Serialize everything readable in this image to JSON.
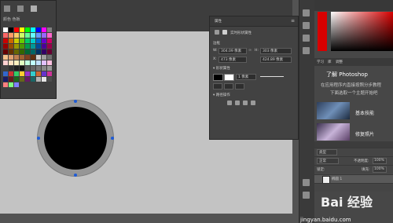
{
  "swatches_panel": {
    "title": "颜色 色板",
    "colors": [
      "#ffffff",
      "#000000",
      "#ff0000",
      "#ffff00",
      "#00ff00",
      "#00ffff",
      "#0000ff",
      "#ff00ff",
      "#808080",
      "#ff6666",
      "#ff9966",
      "#ffcc66",
      "#ccff66",
      "#66ff99",
      "#66ffff",
      "#6699ff",
      "#9966ff",
      "#ff66cc",
      "#cc0000",
      "#cc6600",
      "#cccc00",
      "#66cc00",
      "#00cc66",
      "#00cccc",
      "#0066cc",
      "#6600cc",
      "#cc0066",
      "#990000",
      "#994c00",
      "#999900",
      "#4c9900",
      "#00994c",
      "#009999",
      "#004c99",
      "#4c0099",
      "#99004c",
      "#660000",
      "#663300",
      "#666600",
      "#336600",
      "#006633",
      "#006666",
      "#003366",
      "#330066",
      "#660033",
      "#f5c18a",
      "#e0a070",
      "#c08050",
      "#a06030",
      "#804020",
      "#603010",
      "#d0d0d0",
      "#a0a0a0",
      "#707070",
      "#ffd0d0",
      "#ffe0c0",
      "#fff0c0",
      "#e0ffc0",
      "#c0ffe0",
      "#c0ffff",
      "#c0e0ff",
      "#e0c0ff",
      "#ffc0e0",
      "#404040",
      "#303030",
      "#202020",
      "#101010",
      "#555555",
      "#666666",
      "#777777",
      "#888888",
      "#999999",
      "#3366cc",
      "#cc3333",
      "#33cc66",
      "#ffcc33",
      "#9933cc",
      "#33cccc",
      "#cc6633",
      "#6633cc",
      "#cc3399",
      "#1a1a66",
      "#661a1a",
      "#1a661a",
      "#66661a",
      "#661a66",
      "#1a6666",
      "#b3b3b3",
      "#e6e6e6",
      "#4d4d4d",
      "#ff8080",
      "#80ff80",
      "#8080ff"
    ]
  },
  "properties": {
    "title": "属性",
    "section_label": "实时形状属性",
    "subsection_bounds": "边框",
    "w_label": "W:",
    "w_value": "304.09 像素",
    "h_label": "H:",
    "h_value": "303 像素",
    "x_label": "X:",
    "x_value": "473 像素",
    "y_value": "424.89 像素",
    "subsection_fill_stroke": "1 像素",
    "fill_stroke_header": "▾ 形状属性",
    "subsection_path_ops": "▾ 路径操作"
  },
  "learn_panel": {
    "tabs": [
      "学习",
      "库",
      "调整"
    ],
    "heading": "了解 Photoshop",
    "desc_line1": "在应用程序内直接按照分步教程",
    "desc_line2": "下面选取一个主题开始吧",
    "items": [
      "基本技能",
      "修复照片"
    ]
  },
  "layers_panel": {
    "kind_label": "类型",
    "blend_mode": "正常",
    "opacity_label": "不透明度:",
    "opacity_value": "100%",
    "lock_label": "锁定:",
    "fill_label": "填充:",
    "fill_value": "100%",
    "layer_name": "椭圆 1"
  },
  "watermark": {
    "text": "Bai 经验",
    "url": "jingyan.baidu.com"
  },
  "colors": {
    "canvas": "#c3c3c3",
    "circle_fill": "#000000",
    "circle_stroke": "#969696",
    "anchor": "#1e5bd6"
  }
}
